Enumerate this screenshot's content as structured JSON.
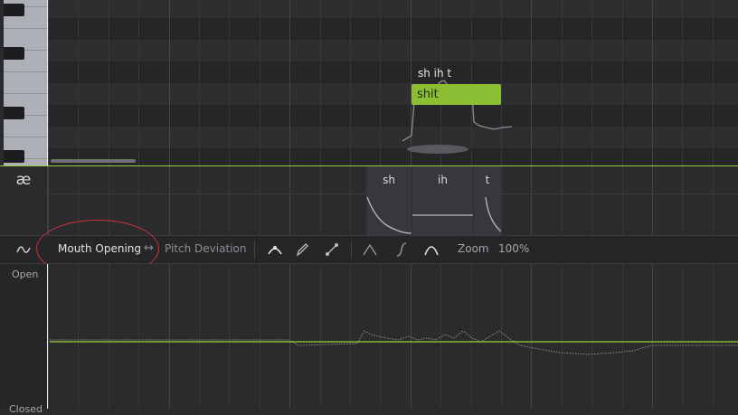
{
  "note": {
    "lyric": "shit",
    "phonemes_text": "sh ih t",
    "color": "#8bbd35"
  },
  "phoneme_lane": {
    "icon_text": "æ",
    "phonemes": [
      "sh",
      "ih",
      "t"
    ]
  },
  "toolbar": {
    "curve_icon": "wave-icon",
    "mouth_opening_label": "Mouth Opening",
    "swap_icon": "↔",
    "pitch_deviation_label": "Pitch Deviation",
    "tools": [
      "bezier-pen-icon",
      "pencil-icon",
      "line-tool-icon"
    ],
    "shapes": [
      "peak-shape-icon",
      "s-curve-shape-icon",
      "arch-shape-icon"
    ],
    "zoom_label": "Zoom",
    "zoom_value": "100%",
    "highlight_color": "#c8323c"
  },
  "automation": {
    "label_top": "Open",
    "label_bottom": "Closed",
    "line_color": "#9acd3c"
  }
}
